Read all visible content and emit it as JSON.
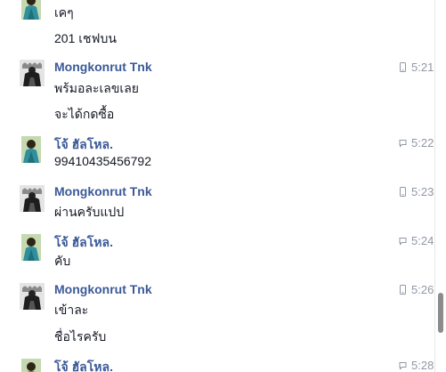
{
  "conversation": {
    "top_sender_partial": {
      "avatar": "person-avatar-teal",
      "lines": [
        "เคๆ",
        "201 เชฟบน"
      ]
    },
    "messages": [
      {
        "sender": "Mongkonrut Tnk",
        "avatar": "figure-black-white-avatar",
        "lines": [
          "พร้มอละเลขเลย",
          "จะได้กดซื้อ"
        ],
        "time": "5:21",
        "via": "mobile-phone-icon"
      },
      {
        "sender": "โจ้ ฮัลโหล.",
        "avatar": "person-avatar-teal",
        "lines": [
          "99410435456792"
        ],
        "time": "5:22",
        "via": "chat-bubble-icon"
      },
      {
        "sender": "Mongkonrut Tnk",
        "avatar": "figure-black-white-avatar",
        "lines": [
          "ผ่านครับแปป"
        ],
        "time": "5:23",
        "via": "mobile-phone-icon"
      },
      {
        "sender": "โจ้ ฮัลโหล.",
        "avatar": "person-avatar-teal",
        "lines": [
          "คับ"
        ],
        "time": "5:24",
        "via": "chat-bubble-icon"
      },
      {
        "sender": "Mongkonrut Tnk",
        "avatar": "figure-black-white-avatar",
        "lines": [
          "เข้าละ",
          "ชื่อไรครับ"
        ],
        "time": "5:26",
        "via": "mobile-phone-icon"
      },
      {
        "sender": "โจ้ ฮัลโหล.",
        "avatar": "person-avatar-teal",
        "lines": [],
        "time": "5:28",
        "via": "chat-bubble-icon"
      }
    ]
  },
  "scrollbar": {
    "position_fraction": 0.9
  },
  "colors": {
    "sender_name": "#3b5998",
    "message_text": "#141823",
    "timestamp": "#9197a3",
    "background": "#ffffff",
    "scroll_thumb": "#8c8c8c"
  }
}
